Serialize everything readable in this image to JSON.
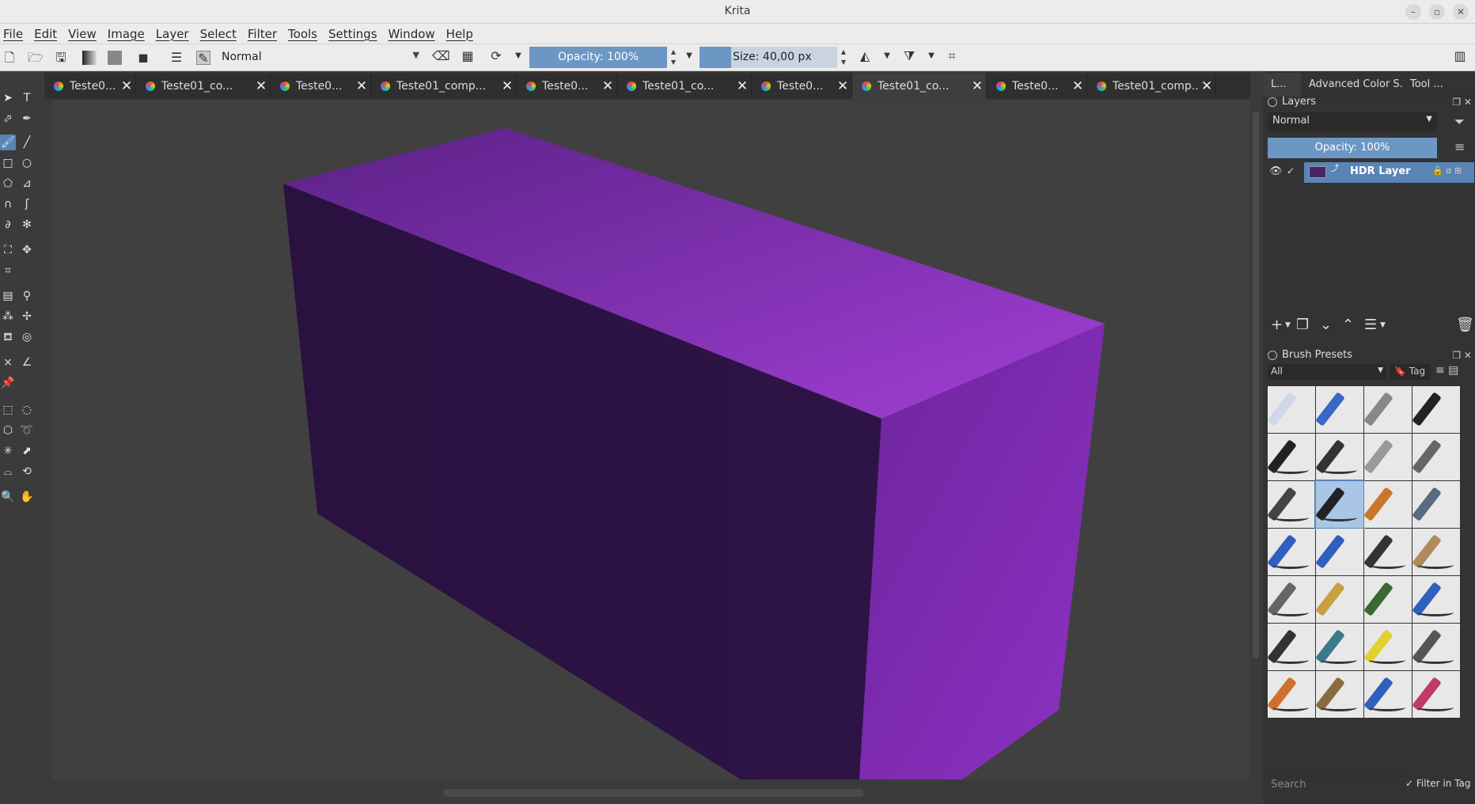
{
  "window": {
    "title": "Krita"
  },
  "menu": [
    "File",
    "Edit",
    "View",
    "Image",
    "Layer",
    "Select",
    "Filter",
    "Tools",
    "Settings",
    "Window",
    "Help"
  ],
  "toolbar": {
    "blend_mode": "Normal",
    "opacity": "Opacity: 100%",
    "size": "Size: 40,00 px"
  },
  "tabs": [
    {
      "label": "Teste0..."
    },
    {
      "label": "Teste01_co..."
    },
    {
      "label": "Teste0..."
    },
    {
      "label": "Teste01_comp..."
    },
    {
      "label": "Teste0..."
    },
    {
      "label": "Teste01_co..."
    },
    {
      "label": "Teste0..."
    },
    {
      "label": "Teste01_co..."
    },
    {
      "label": "Teste0..."
    },
    {
      "label": "Teste01_comp..."
    }
  ],
  "dock": {
    "tabs": [
      "L...",
      "Advanced Color S...",
      "Tool ..."
    ],
    "layers": {
      "title": "Layers",
      "blend_mode": "Normal",
      "opacity": "Opacity:  100%",
      "layer_name": "HDR Layer"
    },
    "brushes": {
      "title": "Brush Presets",
      "filter": "All",
      "tag": "Tag",
      "search_placeholder": "Search",
      "filter_in_tag": "Filter in Tag"
    }
  },
  "colors": {
    "accent": "#5a84b5",
    "box_top": "#8a36c2",
    "box_front": "#2d1440",
    "box_side": "#7a2aa8"
  }
}
